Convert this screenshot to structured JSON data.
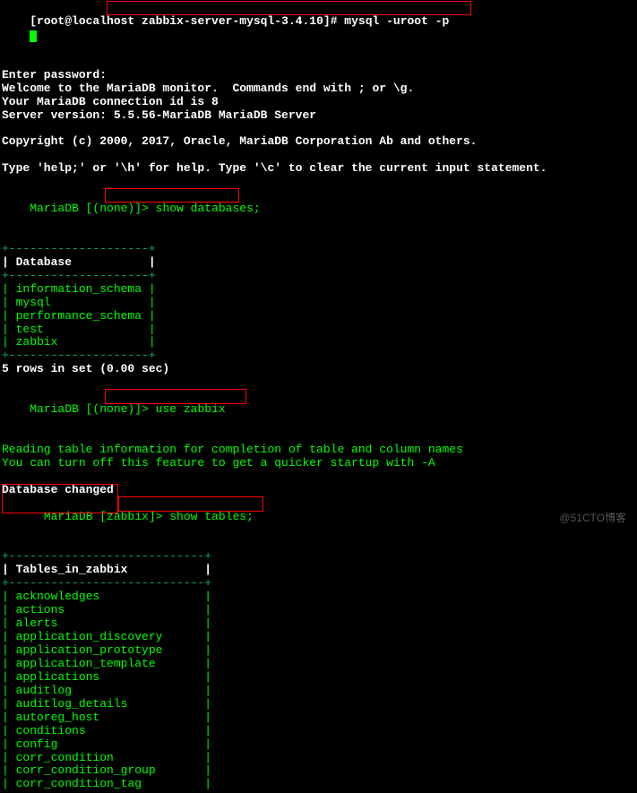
{
  "line1": {
    "prompt_open": "[root@localhost ",
    "dir": "zabbix-server-mysql-3.4.10",
    "prompt_close": "]# ",
    "cmd": "mysql -uroot -p"
  },
  "line2": "Enter password:",
  "line3": "Welcome to the MariaDB monitor.  Commands end with ; or \\g.",
  "line4": "Your MariaDB connection id is 8",
  "line5": "Server version: 5.5.56-MariaDB MariaDB Server",
  "line6": "Copyright (c) 2000, 2017, Oracle, MariaDB Corporation Ab and others.",
  "line7": "Type 'help;' or '\\h' for help. Type '\\c' to clear the current input statement.",
  "prompt_none": "MariaDB [(none)]> ",
  "prompt_zabbix": "MariaDB [zabbix]> ",
  "cmd_showdb": "show databases;",
  "cmd_usezab": "use zabbix",
  "cmd_showtbl": "show tables;",
  "sep_db": "+--------------------+",
  "hdr_db": "| Database           |",
  "databases": {
    "r1": "| information_schema |",
    "r2": "| mysql              |",
    "r3": "| performance_schema |",
    "r4": "| test               |",
    "r5": "| zabbix             |"
  },
  "rows_msg": "5 rows in set (0.00 sec)",
  "read_msg1": "Reading table information for completion of table and column names",
  "read_msg2": "You can turn off this feature to get a quicker startup with -A",
  "dbchanged": "Database changed",
  "sep_tbl": "+----------------------------+",
  "hdr_tbl": "| Tables_in_zabbix           |",
  "tables": {
    "r1": "| acknowledges               |",
    "r2": "| actions                    |",
    "r3": "| alerts                     |",
    "r4": "| application_discovery      |",
    "r5": "| application_prototype      |",
    "r6": "| application_template       |",
    "r7": "| applications               |",
    "r8": "| auditlog                   |",
    "r9": "| auditlog_details           |",
    "r10": "| autoreg_host               |",
    "r11": "| conditions                 |",
    "r12": "| config                     |",
    "r13": "| corr_condition             |",
    "r14": "| corr_condition_group       |",
    "r15": "| corr_condition_tag         |"
  },
  "watermark": "@51CTO博客"
}
